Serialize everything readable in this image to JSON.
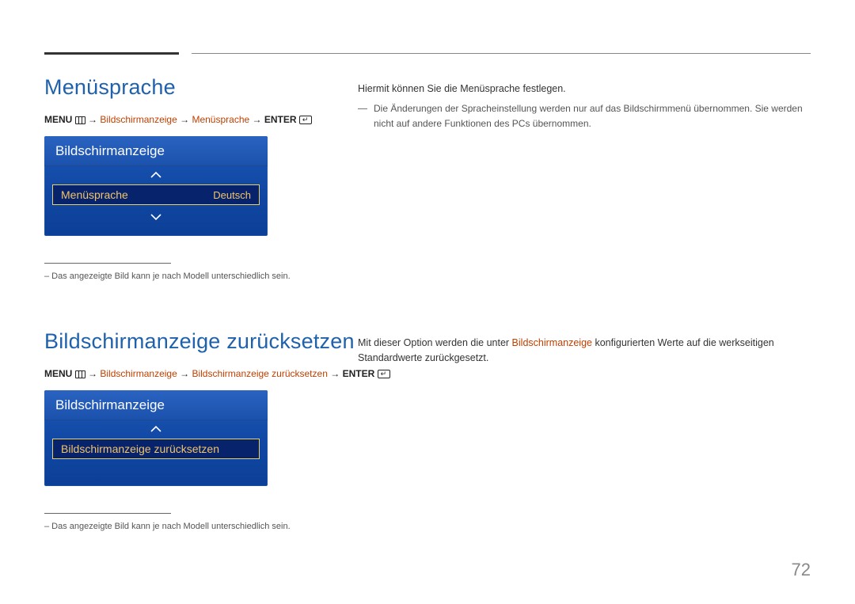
{
  "page_number": "72",
  "section1": {
    "heading": "Menüsprache",
    "breadcrumb": {
      "menu": "MENU",
      "arrow": "→",
      "p1": "Bildschirmanzeige",
      "p2": "Menüsprache",
      "enter": "ENTER"
    },
    "osd": {
      "title": "Bildschirmanzeige",
      "row_label": "Menüsprache",
      "row_value": "Deutsch"
    },
    "footnote": "–  Das angezeigte Bild kann je nach Modell unterschiedlich sein.",
    "right": {
      "lead": "Hiermit können Sie die Menüsprache festlegen.",
      "dash_text": "Die Änderungen der Spracheinstellung werden nur auf das Bildschirmmenü übernommen. Sie werden nicht auf andere Funktionen des PCs übernommen."
    }
  },
  "section2": {
    "heading": "Bildschirmanzeige zurücksetzen",
    "breadcrumb": {
      "menu": "MENU",
      "arrow": "→",
      "p1": "Bildschirmanzeige",
      "p2": "Bildschirmanzeige zurücksetzen",
      "enter": "ENTER"
    },
    "osd": {
      "title": "Bildschirmanzeige",
      "row_label": "Bildschirmanzeige zurücksetzen"
    },
    "footnote": "–  Das angezeigte Bild kann je nach Modell unterschiedlich sein.",
    "right": {
      "before": "Mit dieser Option werden die unter ",
      "hl": "Bildschirmanzeige",
      "after": " konfigurierten Werte auf die werkseitigen Standardwerte zurückgesetzt."
    }
  }
}
